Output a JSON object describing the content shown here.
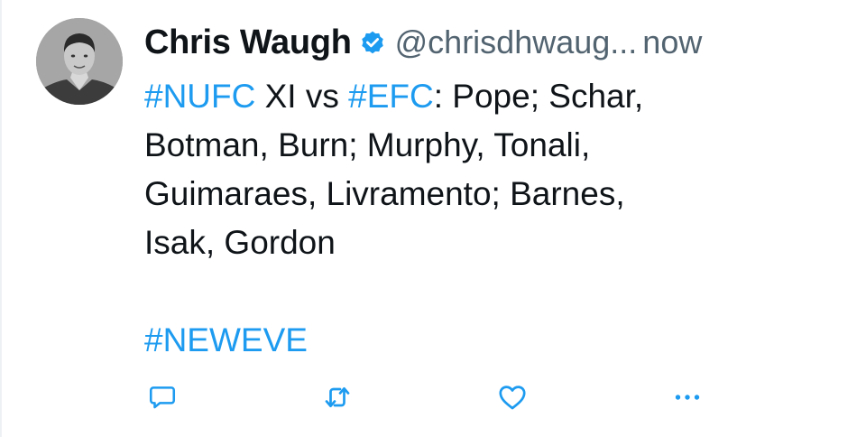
{
  "tweet": {
    "author": {
      "name": "Chris Waugh",
      "handle": "@chrisdhwaug...",
      "verified_icon": "verified-badge-icon"
    },
    "timestamp": "now",
    "lines": [
      [
        {
          "text": "#NUFC",
          "hashtag": true
        },
        {
          "text": " XI vs ",
          "hashtag": false
        },
        {
          "text": "#EFC",
          "hashtag": true
        },
        {
          "text": ": Pope; Schar,",
          "hashtag": false
        }
      ],
      [
        {
          "text": "Botman, Burn; Murphy, Tonali,",
          "hashtag": false
        }
      ],
      [
        {
          "text": "Guimaraes, Livramento; Barnes,",
          "hashtag": false
        }
      ],
      [
        {
          "text": "Isak, Gordon",
          "hashtag": false
        }
      ],
      [
        {
          "text": "",
          "hashtag": false
        }
      ],
      [
        {
          "text": "#NEWEVE",
          "hashtag": true
        }
      ]
    ],
    "actions": [
      {
        "name": "reply-icon"
      },
      {
        "name": "retweet-icon"
      },
      {
        "name": "like-icon"
      },
      {
        "name": "more-icon"
      }
    ]
  },
  "colors": {
    "text": "#0f1419",
    "secondary": "#536471",
    "hashtag": "#1d9bf0",
    "verified": "#1d9bf0"
  }
}
